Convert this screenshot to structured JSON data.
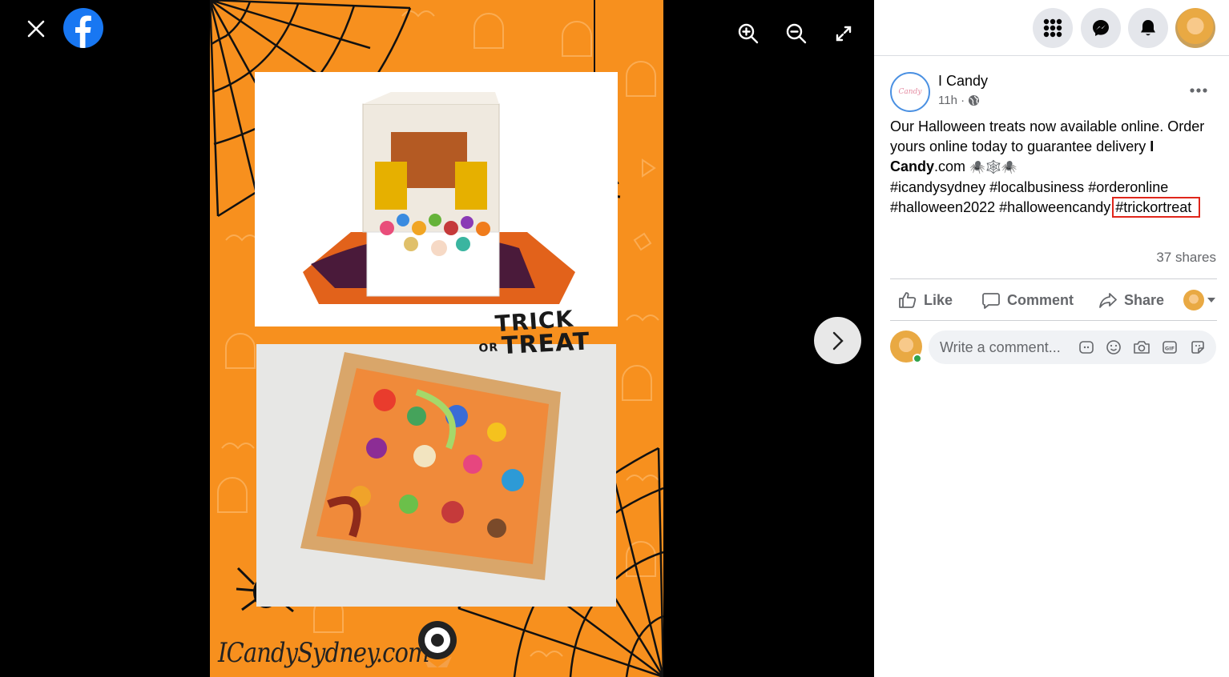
{
  "viewer": {
    "close_icon": "close-icon",
    "logo_icon": "facebook-logo-icon",
    "tools": [
      "zoom-in-icon",
      "zoom-out-icon",
      "fullscreen-icon"
    ],
    "next_icon": "chevron-right-icon"
  },
  "image": {
    "badge_line1": "TRICK",
    "badge_or": "OR",
    "badge_line2": "TREAT",
    "watermark": "ICandySydney.com"
  },
  "topbar": {
    "buttons": [
      "menu-grid-icon",
      "messenger-icon",
      "notifications-icon"
    ]
  },
  "post": {
    "page_name": "I Candy",
    "time": "11h ·",
    "privacy_icon": "globe-icon",
    "text_main": "Our Halloween treats now available online. Order yours online today to guarantee delivery ",
    "link_text": "I Candy",
    "link_suffix": ".com",
    "emojis": "🕷️🕸️🕷️",
    "hashtags": [
      "#icandysydney",
      "#localbusiness",
      "#orderonline",
      "#halloween2022",
      "#halloweencandy",
      "#trickortreat"
    ],
    "shares": "37 shares"
  },
  "actions": {
    "like": "Like",
    "comment": "Comment",
    "share": "Share"
  },
  "comment": {
    "placeholder": "Write a comment..."
  },
  "colors": {
    "poster_orange": "#f7901e",
    "facebook_blue": "#1877f2",
    "highlight_red": "#e0261b"
  }
}
